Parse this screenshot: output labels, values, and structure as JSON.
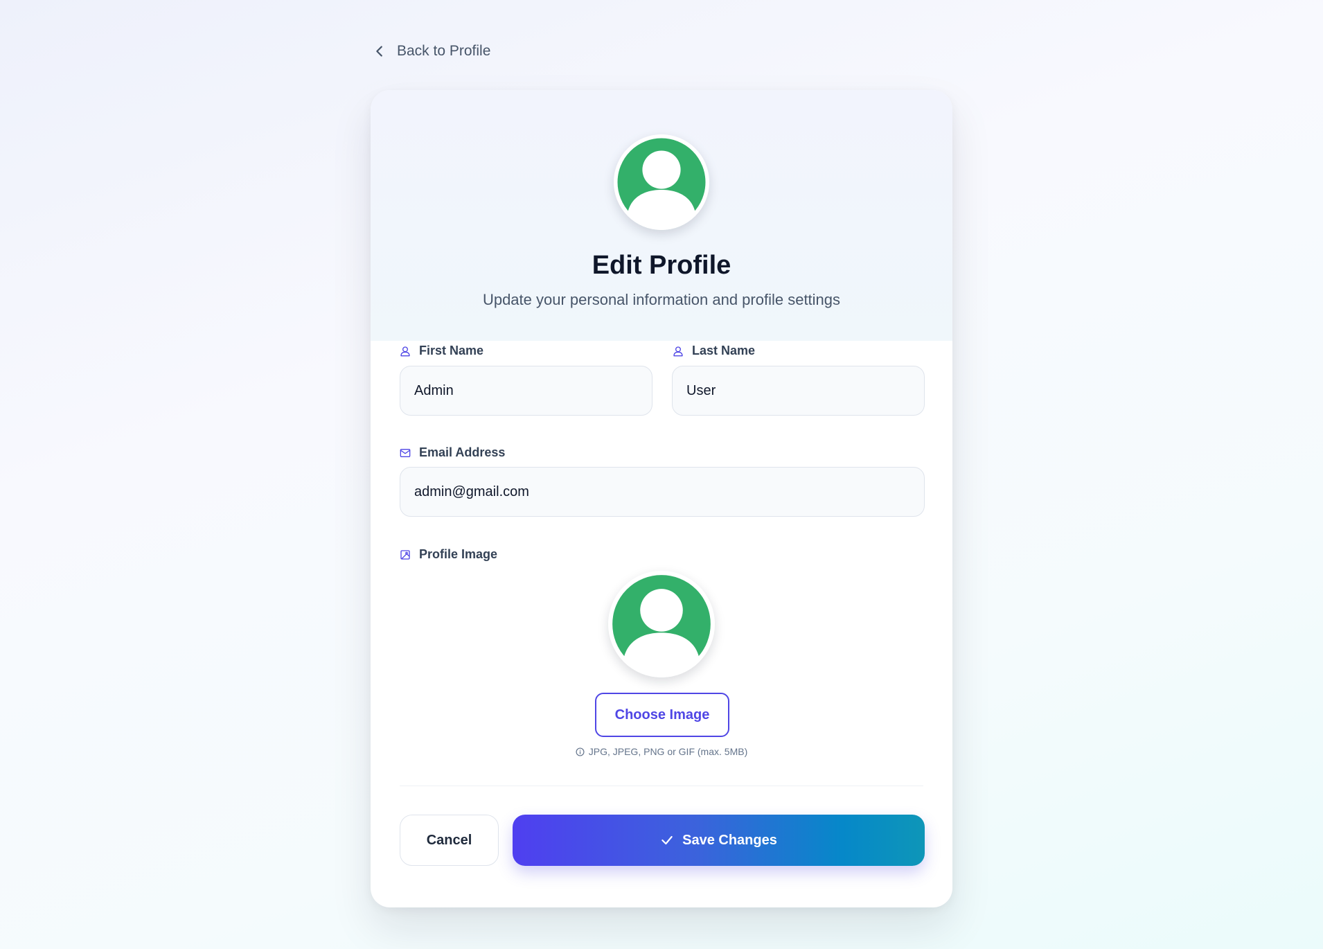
{
  "nav": {
    "back_label": "Back to Profile"
  },
  "header": {
    "title": "Edit Profile",
    "subtitle": "Update your personal information and profile settings"
  },
  "form": {
    "first_name": {
      "label": "First Name",
      "value": "Admin"
    },
    "last_name": {
      "label": "Last Name",
      "value": "User"
    },
    "email": {
      "label": "Email Address",
      "value": "admin@gmail.com"
    },
    "profile_image": {
      "label": "Profile Image",
      "choose_label": "Choose Image",
      "hint": "JPG, JPEG, PNG or GIF (max. 5MB)"
    }
  },
  "actions": {
    "cancel_label": "Cancel",
    "save_label": "Save Changes"
  },
  "colors": {
    "accent": "#4f46e5",
    "avatar_green": "#33b06a",
    "save_gradient_start": "#4f3ff0",
    "save_gradient_end": "#0e96b8"
  },
  "icons": {
    "back": "chevron-left-icon",
    "first_name": "user-icon",
    "last_name": "user-icon",
    "email": "mail-icon",
    "profile_image": "image-icon",
    "hint": "info-icon",
    "save": "check-icon"
  }
}
